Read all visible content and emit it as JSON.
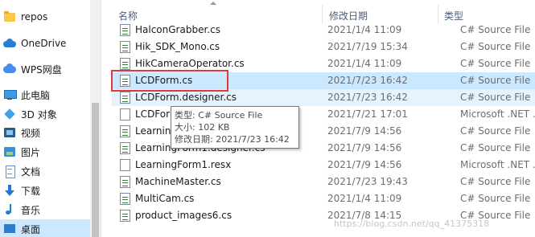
{
  "nav": {
    "items": [
      {
        "label": "repos",
        "icon": "folder-icon"
      },
      {
        "label": "OneDrive",
        "icon": "onedrive-icon"
      },
      {
        "label": "WPS网盘",
        "icon": "wps-cloud-icon"
      },
      {
        "label": "此电脑",
        "icon": "this-pc-icon"
      },
      {
        "label": "3D 对象",
        "icon": "3d-objects-icon"
      },
      {
        "label": "视频",
        "icon": "videos-icon"
      },
      {
        "label": "图片",
        "icon": "pictures-icon"
      },
      {
        "label": "文档",
        "icon": "documents-icon"
      },
      {
        "label": "下载",
        "icon": "downloads-icon"
      },
      {
        "label": "音乐",
        "icon": "music-icon"
      },
      {
        "label": "桌面",
        "icon": "desktop-icon"
      }
    ]
  },
  "header": {
    "name": "名称",
    "date": "修改日期",
    "type": "类型"
  },
  "files": [
    {
      "name": "HalconGrabber.cs",
      "date": "2021/1/4 11:09",
      "type": "C# Source File"
    },
    {
      "name": "Hik_SDK_Mono.cs",
      "date": "2021/7/19 15:34",
      "type": "C# Source File"
    },
    {
      "name": "HikCameraOperator.cs",
      "date": "2021/1/4 11:09",
      "type": "C# Source File"
    },
    {
      "name": "LCDForm.cs",
      "date": "2021/7/23 16:42",
      "type": "C# Source File"
    },
    {
      "name": "LCDForm.designer.cs",
      "date": "2021/7/23 16:42",
      "type": "C# Source File"
    },
    {
      "name": "LCDForm.resx",
      "date": "2021/7/21 17:01",
      "type": "Microsoft .NET ..."
    },
    {
      "name": "LearningForm1.cs",
      "date": "2021/7/9 14:56",
      "type": "C# Source File"
    },
    {
      "name": "LearningForm1.designer.cs",
      "date": "2021/7/9 14:56",
      "type": "C# Source File"
    },
    {
      "name": "LearningForm1.resx",
      "date": "2021/7/9 14:56",
      "type": "Microsoft .NET ..."
    },
    {
      "name": "MachineMaster.cs",
      "date": "2021/7/23 19:43",
      "type": "C# Source File"
    },
    {
      "name": "MultiCam.cs",
      "date": "2021/1/4 11:09",
      "type": "C# Source File"
    },
    {
      "name": "product_images6.cs",
      "date": "2021/7/8 14:15",
      "type": "C# Source File"
    }
  ],
  "tooltip": {
    "type_line": "类型: C# Source File",
    "size_line": "大小: 102 KB",
    "date_line": "修改日期: 2021/7/23 16:42"
  },
  "watermark": "https://blog.csdn.net/qq_41375318",
  "colors": {
    "selection": "#cce8ff",
    "hover": "#e5f3ff",
    "highlight_box": "#e0393a"
  }
}
